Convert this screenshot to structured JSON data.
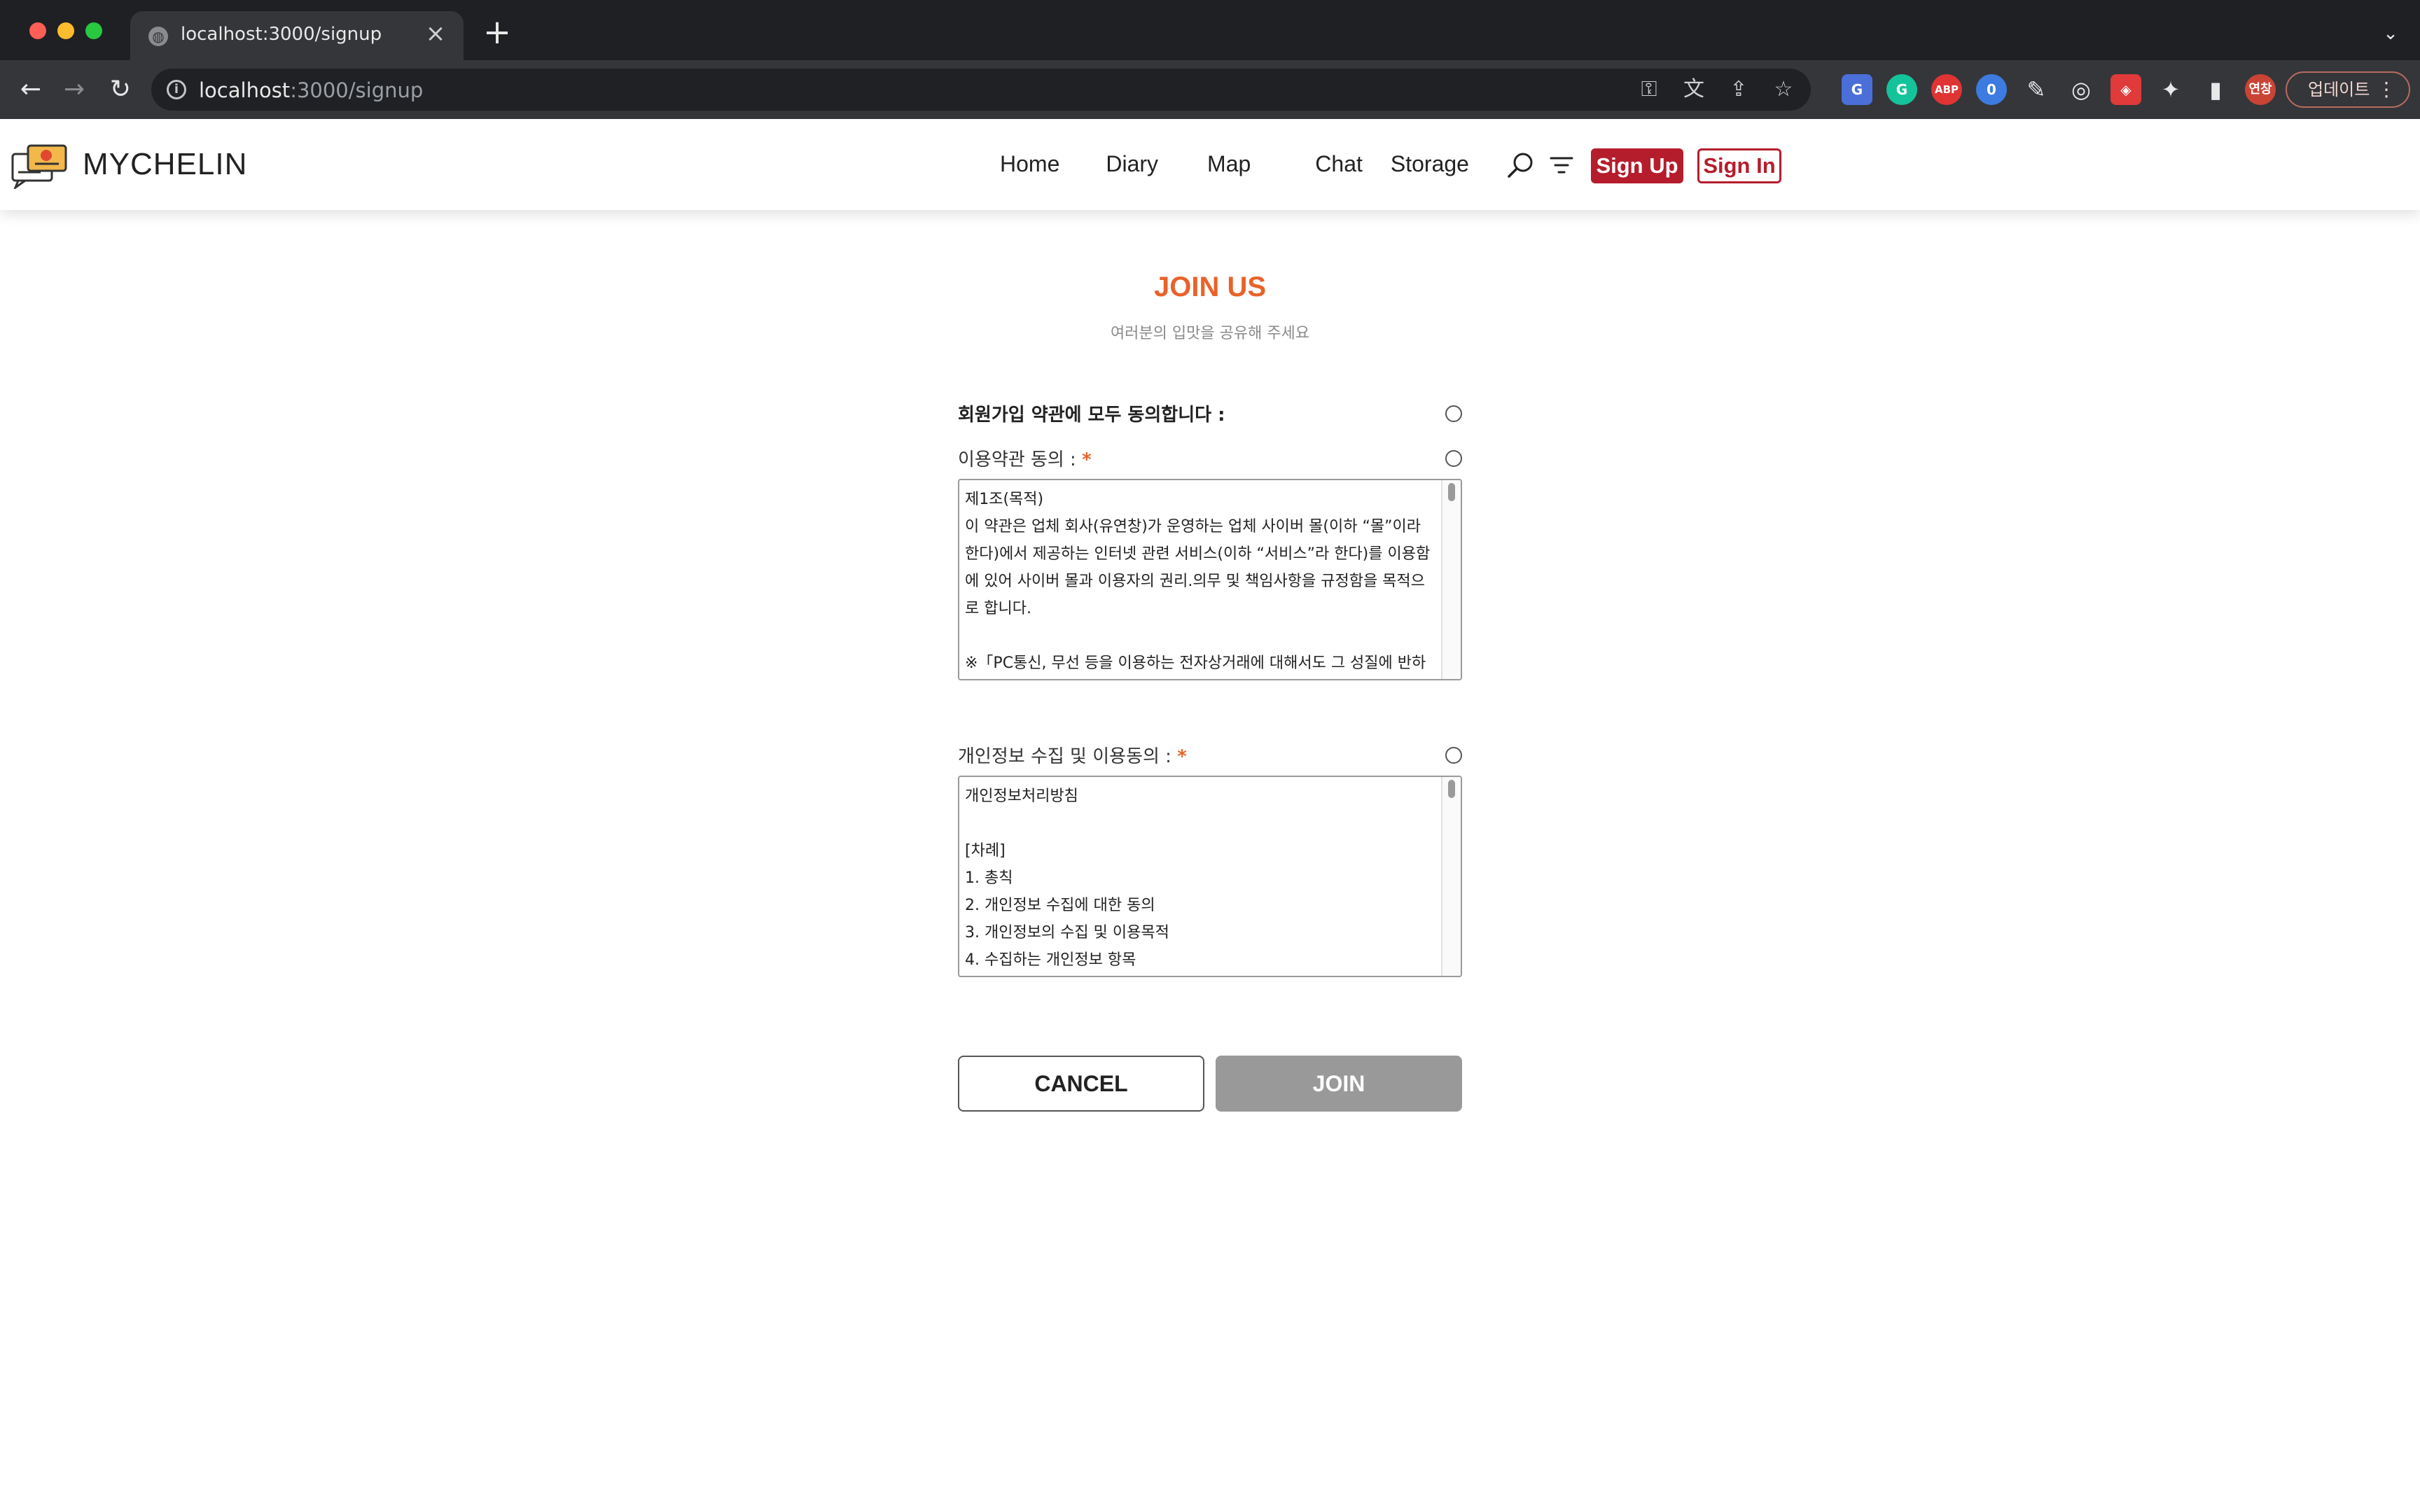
{
  "browser": {
    "tab_title": "localhost:3000/signup",
    "new_tab": "+",
    "close": "×",
    "url_host": "localhost",
    "url_path": ":3000/signup",
    "update_label": "업데이트",
    "avatar_text": "연창"
  },
  "header": {
    "logo_text": "MYCHELIN",
    "nav": [
      "Home",
      "Diary",
      "Map",
      "Chat",
      "Storage"
    ],
    "signup_label": "Sign Up",
    "signin_label": "Sign In",
    "accent_color": "#b51d2c"
  },
  "main": {
    "title": "JOIN US",
    "subtitle": "여러분의 입맛을 공유해 주세요",
    "agree_all_label": "회원가입 약관에 모두 동의합니다 :",
    "terms_label": "이용약관 동의 :",
    "privacy_label": "개인정보 수집 및 이용동의 :",
    "required_mark": "*",
    "terms_text": "제1조(목적)\n이 약관은 업체 회사(유연창)가 운영하는 업체 사이버 몰(이하 “몰”이라\n한다)에서 제공하는 인터넷 관련 서비스(이하 “서비스”라 한다)를 이용함\n에 있어 사이버 몰과 이용자의 권리.의무 및 책임사항을 규정함을 목적으\n로 합니다.\n\n※「PC통신, 무선 등을 이용하는 전자상거래에 대해서도 그 성질에 반하",
    "privacy_text": "개인정보처리방침\n\n[차례]\n1. 총칙\n2. 개인정보 수집에 대한 동의\n3. 개인정보의 수집 및 이용목적\n4. 수집하는 개인정보 항목",
    "cancel_label": "CANCEL",
    "join_label": "JOIN",
    "title_color": "#e8632a"
  }
}
